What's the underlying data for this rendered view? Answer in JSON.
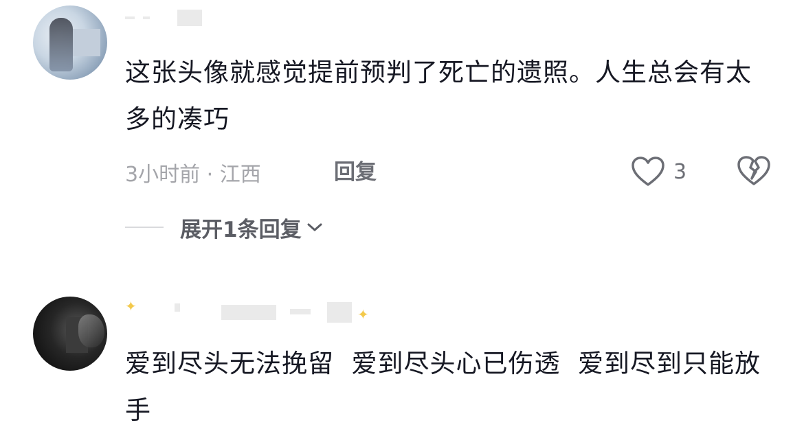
{
  "comments": [
    {
      "text": "这张头像就感觉提前预判了死亡的遗照。人生总会有太多的凑巧",
      "meta": "3小时前 · 江西",
      "reply_label": "回复",
      "like_count": "3",
      "expand_replies_label": "展开1条回复"
    },
    {
      "text": "爱到尽头无法挽留  爱到尽头心已伤透  爱到尽到只能放手"
    }
  ],
  "icons": {
    "like": "heart-outline-icon",
    "dislike": "broken-heart-icon",
    "expand": "chevron-down-icon"
  },
  "colors": {
    "text": "#161823",
    "meta": "#a4a5aa",
    "action": "#6c6e75"
  }
}
